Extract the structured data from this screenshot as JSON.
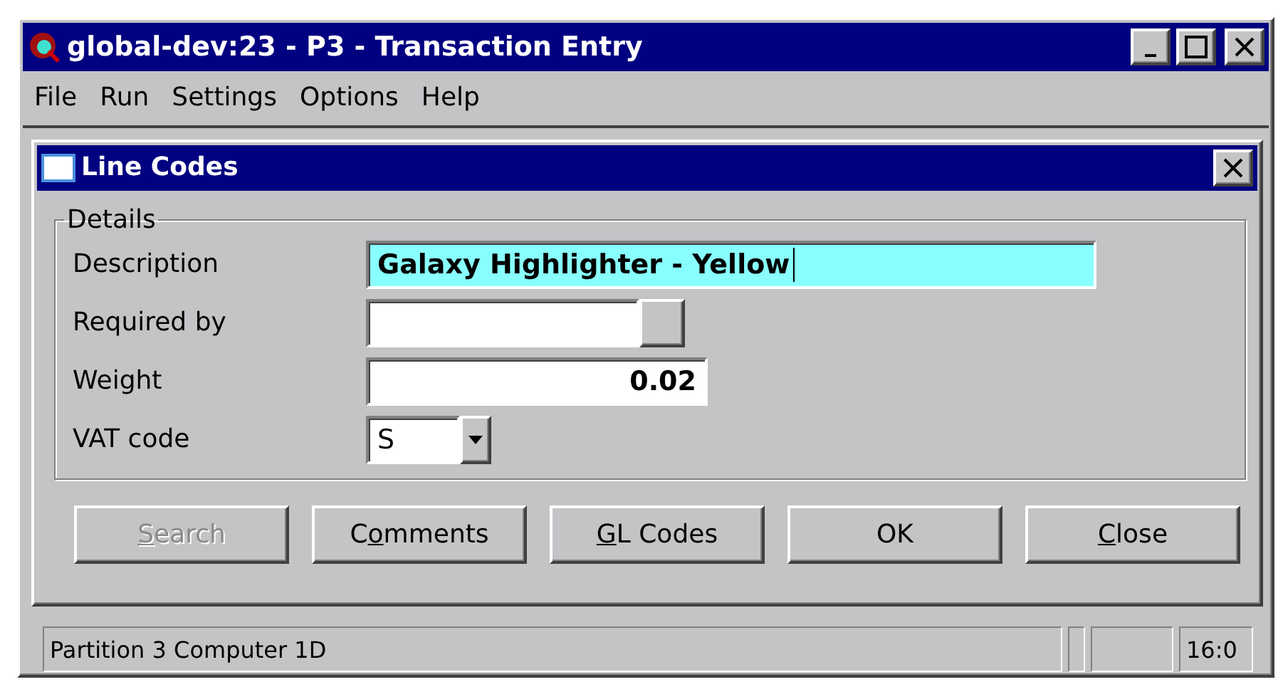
{
  "window": {
    "title": "global-dev:23 - P3 - Transaction Entry"
  },
  "menu": [
    "File",
    "Run",
    "Settings",
    "Options",
    "Help"
  ],
  "dialog": {
    "title": "Line Codes",
    "group": "Details",
    "fields": [
      {
        "kind": "text",
        "label": "Description",
        "value": "Galaxy Highlighter - Yellow",
        "focused": true
      },
      {
        "kind": "date",
        "label": "Required by",
        "focused": false
      },
      {
        "kind": "number",
        "label": "Weight",
        "value": "0.02",
        "focused": false
      },
      {
        "kind": "combo",
        "label": "VAT code",
        "value": "S",
        "focused": false
      }
    ],
    "buttons": [
      {
        "key": "S",
        "after": "earch",
        "disabled": true
      },
      {
        "before": "C",
        "key": "o",
        "after": "mments",
        "disabled": false
      },
      {
        "key": "G",
        "after": "L Codes",
        "disabled": false
      },
      {
        "before": "OK",
        "disabled": false
      },
      {
        "key": "C",
        "after": "lose",
        "disabled": false
      }
    ]
  },
  "status_bar": {
    "message": "Partition 3 Computer 1D",
    "position": "16:0"
  }
}
